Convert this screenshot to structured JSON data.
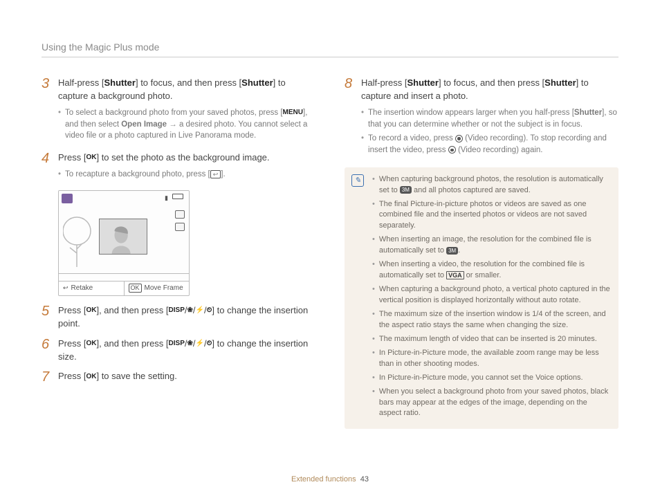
{
  "header": {
    "section_title": "Using the Magic Plus mode"
  },
  "left": {
    "step3": {
      "num": "3",
      "text_pre": "Half-press [",
      "shutter1": "Shutter",
      "text_mid1": "] to focus, and then press [",
      "shutter2": "Shutter",
      "text_post": "] to capture a background photo.",
      "sub_pre": "To select a background photo from your saved photos, press [",
      "menu": "MENU",
      "sub_mid": "], and then select ",
      "open_image": "Open Image",
      "arrow": " → ",
      "sub_tail": "a desired photo. You cannot select a video file or a photo captured in Live Panorama mode."
    },
    "step4": {
      "num": "4",
      "text_pre": "Press [",
      "ok": "OK",
      "text_post": "] to set the photo as the background image.",
      "sub_pre": "To recapture a background photo, press [",
      "back": "↩",
      "sub_post": "]."
    },
    "preview": {
      "retake": "Retake",
      "moveframe": "Move Frame"
    },
    "step5": {
      "num": "5",
      "text_pre": "Press [",
      "ok": "OK",
      "text_mid": "], and then press [",
      "disp": "DISP",
      "sep1": "/",
      "flower": "❀",
      "sep2": "/",
      "flash": "⚡",
      "sep3": "/",
      "timer": "⏲",
      "text_post": "] to change the insertion point."
    },
    "step6": {
      "num": "6",
      "text_pre": "Press [",
      "ok": "OK",
      "text_mid": "], and then press [",
      "disp": "DISP",
      "sep1": "/",
      "flower": "❀",
      "sep2": "/",
      "flash": "⚡",
      "sep3": "/",
      "timer": "⏲",
      "text_post": "] to change the insertion size."
    },
    "step7": {
      "num": "7",
      "text_pre": "Press [",
      "ok": "OK",
      "text_post": "] to save the setting."
    }
  },
  "right": {
    "step8": {
      "num": "8",
      "text_pre": "Half-press [",
      "shutter1": "Shutter",
      "text_mid1": "] to focus, and then press [",
      "shutter2": "Shutter",
      "text_post": "] to capture and insert a photo.",
      "sub1_pre": "The insertion window appears larger when you half-press [",
      "sub1_shutter": "Shutter",
      "sub1_post": "], so that you can determine whether or not the subject is in focus.",
      "sub2_pre": "To record a video, press ",
      "sub2_rec1": "(Video recording)",
      "sub2_mid": ". To stop recording and insert the video, press ",
      "sub2_rec2": "(Video recording)",
      "sub2_post": " again."
    },
    "notes": {
      "n1_pre": "When capturing background photos, the resolution is automatically set to ",
      "n1_pill": "3M",
      "n1_post": " and all photos captured are saved.",
      "n2": "The final Picture-in-picture photos or videos are saved as one combined file and the inserted photos or videos are not saved separately.",
      "n3_pre": "When inserting an image, the resolution for the combined file is automatically set to ",
      "n3_pill": "3M",
      "n3_post": ".",
      "n4_pre": "When inserting a video, the resolution for the combined file is automatically set to ",
      "n4_vga": "VGA",
      "n4_post": " or smaller.",
      "n5": "When capturing a background photo, a vertical photo captured in the vertical position is displayed horizontally without auto rotate.",
      "n6": "The maximum size of the insertion window is 1/4 of the screen, and the aspect ratio stays the same when changing the size.",
      "n7": "The maximum length of video that can be inserted is 20 minutes.",
      "n8": "In Picture-in-Picture mode, the available zoom range may be less than in other shooting modes.",
      "n9": "In Picture-in-Picture mode, you cannot set the Voice options.",
      "n10": "When you select a background photo from your saved photos, black bars may appear at the edges of the image, depending on the aspect ratio."
    }
  },
  "footer": {
    "label": "Extended functions",
    "page": "43"
  }
}
